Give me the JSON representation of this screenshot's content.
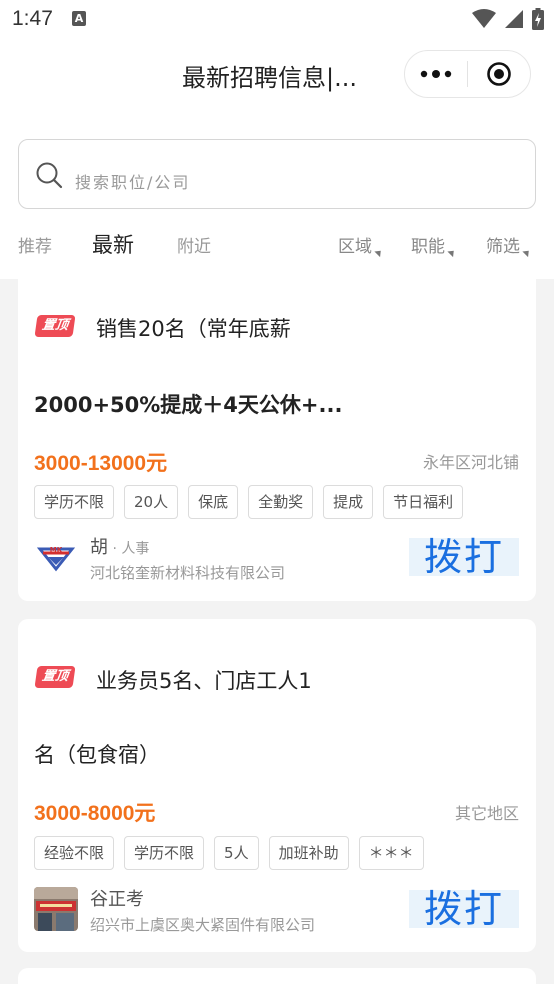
{
  "status": {
    "time": "1:47",
    "notification_icon": "A"
  },
  "nav": {
    "title": "最新招聘信息|..."
  },
  "search": {
    "placeholder": "搜索职位/公司"
  },
  "tabs": [
    {
      "label": "推荐"
    },
    {
      "label": "最新"
    },
    {
      "label": "附近"
    }
  ],
  "active_tab": "最新",
  "filters": [
    {
      "label": "区域"
    },
    {
      "label": "职能"
    },
    {
      "label": "筛选"
    }
  ],
  "jobs": [
    {
      "badge": "置顶",
      "title_line1": "销售20名（常年底薪",
      "title_line2": "2000+50%提成＋4天公休+...",
      "salary": "3000-13000元",
      "location": "永年区河北铺",
      "tags": [
        "学历不限",
        "20人",
        "保底",
        "全勤奖",
        "提成",
        "节日福利"
      ],
      "contact_name": "胡",
      "contact_role": " · 人事",
      "company": "河北铭奎新材料科技有限公司",
      "call_label": "拨打"
    },
    {
      "badge": "置顶",
      "title_line1": "业务员5名、门店工人1",
      "title_line2": "名（包食宿）",
      "salary": "3000-8000元",
      "location": "其它地区",
      "tags": [
        "经验不限",
        "学历不限",
        "5人",
        "加班补助",
        "＊＊＊"
      ],
      "contact_name": "谷正考",
      "contact_role": "",
      "company": "绍兴市上虞区奥大紧固件有限公司",
      "call_label": "拨打"
    }
  ],
  "colors": {
    "salary": "#f2711c",
    "badge": "#ee4b55",
    "call": "#1a6fe0"
  }
}
